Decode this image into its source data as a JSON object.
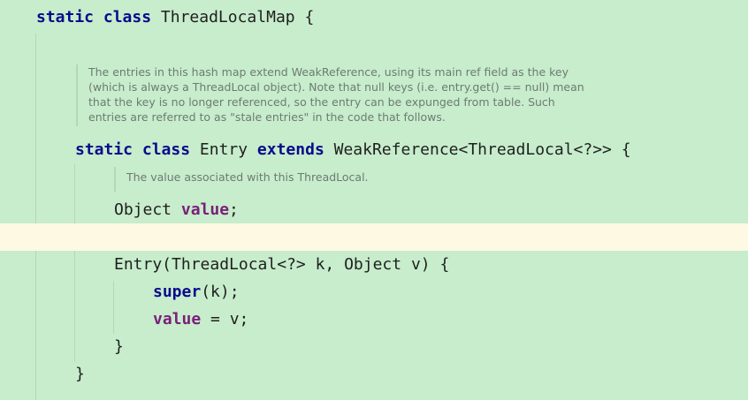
{
  "editor": {
    "colors": {
      "background": "#c7edcc",
      "caret_line": "#fdf9e3",
      "keyword": "#0a0a8c",
      "field": "#7a1f7a",
      "comment": "#6e7a72"
    },
    "class_decl": {
      "kw_static": "static",
      "kw_class": "class",
      "name": " ThreadLocalMap {"
    },
    "map_doc": {
      "lines": [
        "The entries in this hash map extend WeakReference, using its main ref field as the key",
        "(which is always a ThreadLocal object). Note that null keys (i.e. entry.get() == null) mean",
        "that the key is no longer referenced, so the entry can be expunged from table. Such",
        "entries are referred to as \"stale entries\" in the code that follows."
      ]
    },
    "entry_decl": {
      "kw_static": "static",
      "kw_class": "class",
      "name": " Entry ",
      "kw_extends": "extends",
      "super_type": " WeakReference<ThreadLocal<?>> {"
    },
    "value_doc": "The value associated with this ThreadLocal.",
    "value_field": {
      "type": "Object ",
      "name": "value",
      "semicolon": ";"
    },
    "constructor": {
      "signature": "Entry(ThreadLocal<?> k, Object v) {",
      "super_kw": "super",
      "super_args": "(k);",
      "assign_field": "value",
      "assign_rest": " = v;",
      "close": "}"
    },
    "class_close": "}"
  }
}
